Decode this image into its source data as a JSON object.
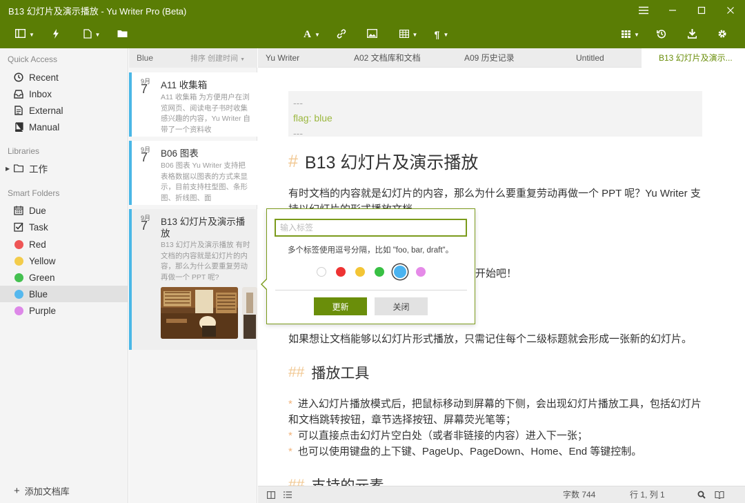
{
  "window": {
    "title": "B13 幻灯片及演示播放 - Yu Writer Pro (Beta)"
  },
  "sidebar": {
    "quick_access_title": "Quick Access",
    "quick_access": [
      {
        "label": "Recent",
        "icon": "clock-icon"
      },
      {
        "label": "Inbox",
        "icon": "inbox-icon"
      },
      {
        "label": "External",
        "icon": "document-icon"
      },
      {
        "label": "Manual",
        "icon": "book-icon"
      }
    ],
    "libraries_title": "Libraries",
    "libraries": [
      {
        "label": "工作",
        "icon": "folder-icon"
      }
    ],
    "smart_folders_title": "Smart Folders",
    "smart_folders": [
      {
        "label": "Due",
        "icon": "calendar-icon"
      },
      {
        "label": "Task",
        "icon": "checkbox-icon"
      },
      {
        "label": "Red",
        "color": "#ee5555"
      },
      {
        "label": "Yellow",
        "color": "#f3cc4b"
      },
      {
        "label": "Green",
        "color": "#44c050"
      },
      {
        "label": "Blue",
        "color": "#55b8ee"
      },
      {
        "label": "Purple",
        "color": "#dd88e8"
      }
    ],
    "add_library": "添加文档库"
  },
  "doclist": {
    "header": "Blue",
    "sort_label": "排序 创建时间",
    "cards": [
      {
        "month": "9月",
        "day": "7",
        "title": "A11 收集箱",
        "excerpt": "A11 收集箱 为方便用户在浏览网页、阅读电子书时收集感兴趣的内容，Yu Writer 自带了一个资料收"
      },
      {
        "month": "9月",
        "day": "7",
        "title": "B06 图表",
        "excerpt": "B06 图表 Yu Writer 支持把表格数据以图表的方式来显示，目前支持柱型图、条形图、折线图、面"
      },
      {
        "month": "9月",
        "day": "7",
        "title": "B13 幻灯片及演示播放",
        "excerpt": "B13 幻灯片及演示播放 有时文档的内容就是幻灯片的内容，那么为什么要重复劳动再做一个 PPT 呢?"
      }
    ]
  },
  "tabs": [
    {
      "label": "Yu Writer"
    },
    {
      "label": "A02 文档库和文档"
    },
    {
      "label": "A09 历史记录"
    },
    {
      "label": "Untitled"
    },
    {
      "label": "B13 幻灯片及演示..."
    }
  ],
  "editor": {
    "front_dashes_top": "---",
    "front_key": "flag:",
    "front_value": "blue",
    "front_dashes_bottom": "---",
    "h1_hash": "#",
    "h1": "B13 幻灯片及演示播放",
    "p1_line1": "有时文档的内容就是幻灯片的内容，那么为什么要重复劳动再做一个 PPT 呢？Yu Writer 支",
    "p1_line2": "持以幻灯片的形式播放文档。",
    "p2_tail": "出开始吧！",
    "p3": "如果想让文档能够以幻灯片形式播放，只需记住每个二级标题就会形成一张新的幻灯片。",
    "h2_hash": "##",
    "h2_1": "播放工具",
    "bullet": "*",
    "li1_line1": "进入幻灯片播放模式后，把鼠标移动到屏幕的下侧，会出现幻灯片播放工具，包括幻灯片",
    "li1_line2": "和文档跳转按钮，章节选择按钮、屏幕荧光笔等；",
    "li2": "可以直接点击幻灯片空白处（或者非链接的内容）进入下一张；",
    "li3": "也可以使用键盘的上下键、PageUp、PageDown、Home、End 等键控制。",
    "h2_2": "支持的元素"
  },
  "status": {
    "word_count": "字数 744",
    "position": "行 1, 列 1"
  },
  "tag_popup": {
    "placeholder": "输入标签",
    "hint": "多个标签使用逗号分隔，比如 \"foo, bar, draft\"。",
    "colors": [
      "#ffffff",
      "#ee3333",
      "#f3c535",
      "#38c044",
      "#4ab3f0",
      "#e58ae8"
    ],
    "selected_color": "#4ab3f0",
    "update_label": "更新",
    "close_label": "关闭"
  },
  "theme": {
    "accent": "#5a7d05",
    "list_marker": "#4ab7e6"
  }
}
